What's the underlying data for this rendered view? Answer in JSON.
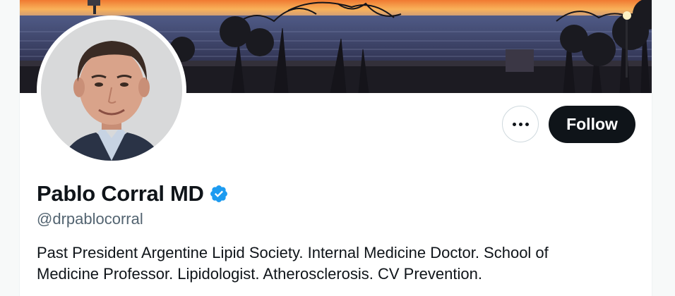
{
  "profile": {
    "display_name": "Pablo Corral MD",
    "handle": "@drpablocorral",
    "bio": "Past President Argentine Lipid Society. Internal Medicine Doctor. School of Medicine Professor. Lipidologist. Atherosclerosis. CV Prevention.",
    "verified": true
  },
  "actions": {
    "more_icon": "more-horizontal-icon",
    "follow_label": "Follow"
  },
  "colors": {
    "verified_badge": "#1d9bf0",
    "follow_bg": "#0f1419",
    "handle_text": "#536471"
  }
}
